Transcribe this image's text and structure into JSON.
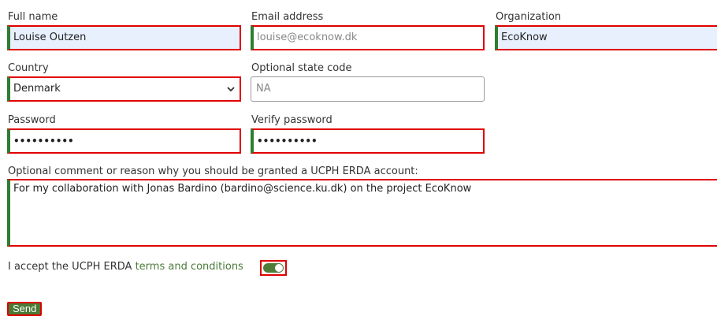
{
  "form": {
    "full_name": {
      "label": "Full name",
      "value": "Louise Outzen"
    },
    "email": {
      "label": "Email address",
      "placeholder": "louise@ecoknow.dk"
    },
    "organization": {
      "label": "Organization",
      "value": "EcoKnow"
    },
    "country": {
      "label": "Country",
      "selected": "Denmark"
    },
    "state_code": {
      "label": "Optional state code",
      "placeholder": "NA"
    },
    "password": {
      "label": "Password",
      "masked": "••••••••••"
    },
    "verify_password": {
      "label": "Verify password",
      "masked": "••••••••••"
    },
    "comment": {
      "label": "Optional comment or reason why you should be granted a UCPH ERDA account:",
      "value": "For my collaboration with Jonas Bardino (bardino@science.ku.dk) on the project EcoKnow"
    },
    "accept": {
      "prefix": "I accept the UCPH ERDA ",
      "link": "terms and conditions",
      "checked": true
    },
    "send_label": "Send"
  },
  "colors": {
    "accent_green": "#4b7a36",
    "highlight_red": "#e00000",
    "autofill_bg": "#e8f0fe"
  }
}
